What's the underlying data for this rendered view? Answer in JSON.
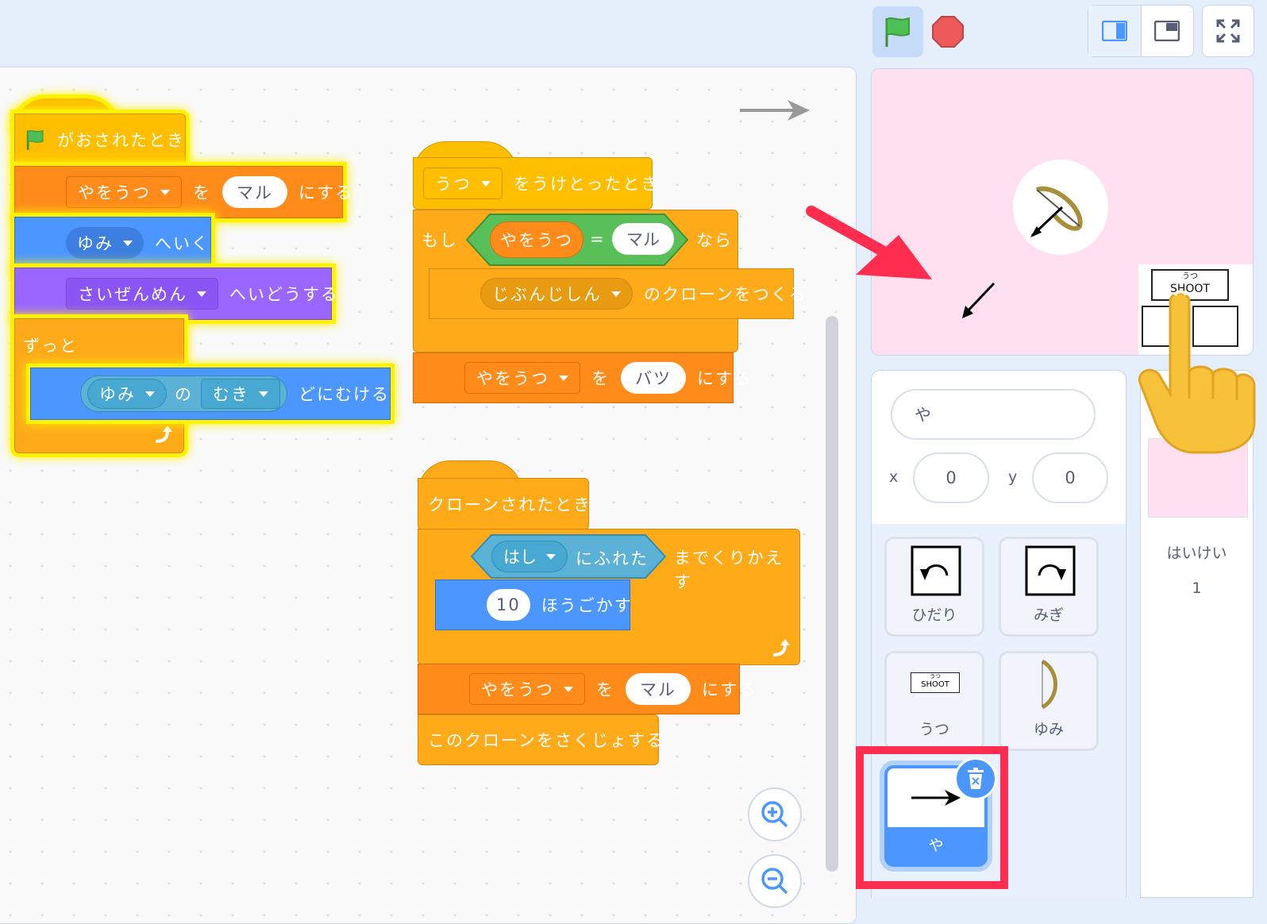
{
  "toolbar": {
    "green_flag_icon": "green-flag-icon",
    "stop_icon": "stop-sign-icon",
    "layout_small_icon": "small-stage-icon",
    "layout_large_icon": "large-stage-icon",
    "fullscreen_icon": "fullscreen-icon"
  },
  "script1": {
    "hat": "がおされたとき",
    "set_var": {
      "var": "やをうつ",
      "to": "を",
      "value": "マル",
      "suffix": "にする"
    },
    "go_to": {
      "target": "ゆみ",
      "suffix": "へいく"
    },
    "go_layer": {
      "layer": "さいぜんめん",
      "suffix": "へいどうする"
    },
    "forever": "ずっと",
    "point": {
      "sprite": "ゆみ",
      "of": "の",
      "prop": "むき",
      "suffix": "どにむける"
    }
  },
  "script2": {
    "hat": {
      "msg": "うつ",
      "suffix": "をうけとったとき"
    },
    "if": {
      "label": "もし",
      "var": "やをうつ",
      "eq": "=",
      "value": "マル",
      "then": "なら"
    },
    "clone": {
      "target": "じぶんじしん",
      "suffix": "のクローンをつくる"
    },
    "set_var": {
      "var": "やをうつ",
      "to": "を",
      "value": "バツ",
      "suffix": "にする"
    }
  },
  "script3": {
    "hat": "クローンされたとき",
    "repeat_until": {
      "target": "はし",
      "touch": "にふれた",
      "suffix": "までくりかえす"
    },
    "move": {
      "steps": "10",
      "suffix": "ほうごかす"
    },
    "set_var": {
      "var": "やをうつ",
      "to": "を",
      "value": "マル",
      "suffix": "にする"
    },
    "delete": "このクローンをさくじょする"
  },
  "stage": {
    "shoot_small": "うつ",
    "shoot_label": "SHOOT"
  },
  "sprite_info": {
    "name": "や",
    "x_label": "x",
    "x_value": "0",
    "y_label": "y",
    "y_value": "0"
  },
  "sprites": [
    {
      "label": "ひだり"
    },
    {
      "label": "みぎ"
    },
    {
      "label": "うつ",
      "thumb_small": "うつ",
      "thumb_text": "SHOOT"
    },
    {
      "label": "ゆみ"
    },
    {
      "label": "や"
    }
  ],
  "backdrop": {
    "label": "はいけい",
    "count": "1"
  },
  "colors": {
    "accent": "#4c97ff",
    "highlight": "#ff2d4f",
    "glow": "#fff200"
  }
}
